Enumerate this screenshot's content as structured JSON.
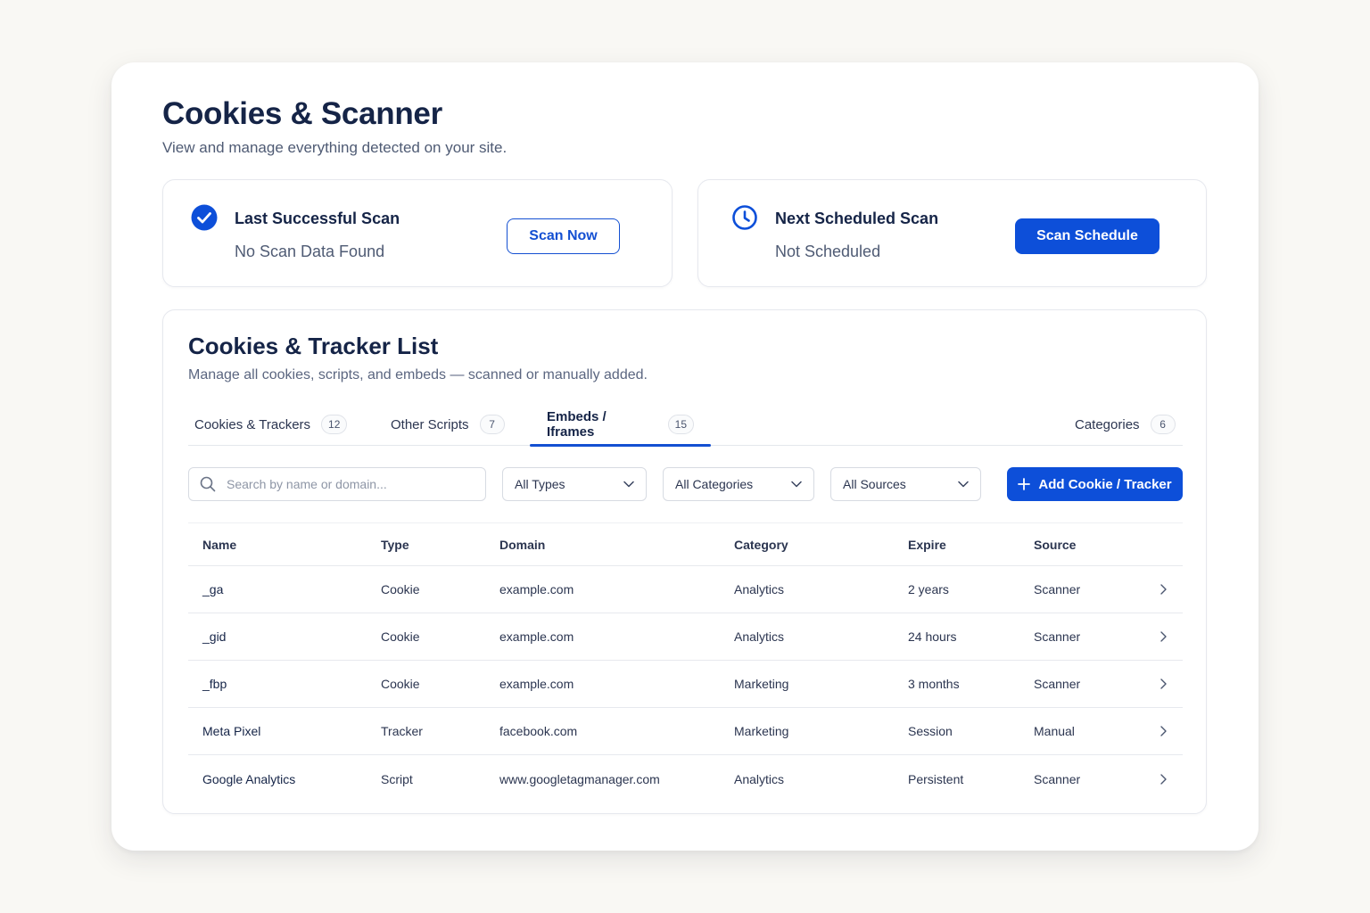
{
  "page": {
    "title": "Cookies & Scanner",
    "subtitle": "View and manage everything detected on your site."
  },
  "scan_cards": {
    "last": {
      "icon": "check-circle-icon",
      "title": "Last Successful Scan",
      "status": "No Scan Data Found",
      "button_label": "Scan Now"
    },
    "next": {
      "icon": "clock-icon",
      "title": "Next Scheduled Scan",
      "status": "Not Scheduled",
      "button_label": "Scan Schedule"
    }
  },
  "list": {
    "title": "Cookies & Tracker List",
    "subtitle": "Manage all cookies, scripts, and embeds — scanned or manually added."
  },
  "tabs": [
    {
      "label": "Cookies & Trackers",
      "count": "12",
      "active": false
    },
    {
      "label": "Other Scripts",
      "count": "7",
      "active": false
    },
    {
      "label": "Embeds / Iframes",
      "count": "15",
      "active": true
    },
    {
      "label": "Categories",
      "count": "6",
      "active": false
    }
  ],
  "filters": {
    "search_placeholder": "Search by name or domain...",
    "type_select": "All Types",
    "category_select": "All Categories",
    "source_select": "All Sources",
    "add_button_label": "Add Cookie / Tracker"
  },
  "table": {
    "columns": [
      "Name",
      "Type",
      "Domain",
      "Category",
      "Expire",
      "Source"
    ],
    "rows": [
      {
        "name": "_ga",
        "type": "Cookie",
        "domain": "example.com",
        "category": "Analytics",
        "expire": "2 years",
        "source": "Scanner"
      },
      {
        "name": "_gid",
        "type": "Cookie",
        "domain": "example.com",
        "category": "Analytics",
        "expire": "24 hours",
        "source": "Scanner"
      },
      {
        "name": "_fbp",
        "type": "Cookie",
        "domain": "example.com",
        "category": "Marketing",
        "expire": "3 months",
        "source": "Scanner"
      },
      {
        "name": "Meta Pixel",
        "type": "Tracker",
        "domain": "facebook.com",
        "category": "Marketing",
        "expire": "Session",
        "source": "Manual"
      },
      {
        "name": "Google Analytics",
        "type": "Script",
        "domain": "www.googletagmanager.com",
        "category": "Analytics",
        "expire": "Persistent",
        "source": "Scanner"
      }
    ]
  },
  "colors": {
    "accent": "#0d4fd9",
    "title_text": "#152447",
    "muted_text": "#4f5b74",
    "background": "#f9f8f4"
  }
}
